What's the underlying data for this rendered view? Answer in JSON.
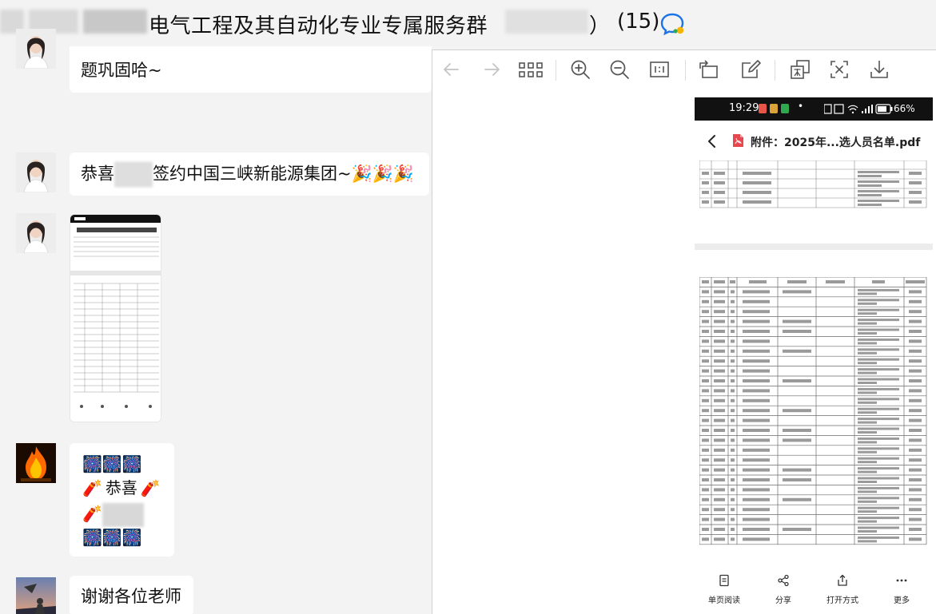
{
  "window": {
    "group_name": "电气工程及其自动化专业专属服务群",
    "paren_close": "）",
    "member_count": "(15)"
  },
  "chat": {
    "messages": [
      {
        "sender": "member-1",
        "text": "题巩固哈~"
      },
      {
        "sender": "member-1",
        "text_before": "恭喜",
        "text_after": "签约中国三峡新能源集团~",
        "emoji": "🎉🎉🎉"
      },
      {
        "sender": "member-1",
        "type": "image"
      },
      {
        "sender": "member-2",
        "sticker_label": "恭喜"
      },
      {
        "sender": "member-3",
        "text": "谢谢各位老师"
      }
    ]
  },
  "viewer": {
    "toolbar": [
      {
        "icon": "back-arrow-icon",
        "enabled": false
      },
      {
        "icon": "forward-arrow-icon",
        "enabled": false
      },
      {
        "icon": "grid-icon",
        "enabled": true
      },
      {
        "icon": "zoom-in-icon",
        "enabled": true
      },
      {
        "icon": "zoom-out-icon",
        "enabled": true
      },
      {
        "icon": "actual-size-icon",
        "enabled": true
      },
      {
        "icon": "rotate-icon",
        "enabled": true
      },
      {
        "icon": "edit-icon",
        "enabled": true
      },
      {
        "icon": "translate-icon",
        "enabled": true
      },
      {
        "icon": "extract-text-icon",
        "enabled": true
      },
      {
        "icon": "download-icon",
        "enabled": true
      }
    ],
    "phone": {
      "time": "19:29",
      "battery": "66%",
      "doc_title": "附件：2025年...选人员名单.pdf",
      "footer": [
        {
          "label": "单页阅读",
          "icon": "single-page-icon"
        },
        {
          "label": "分享",
          "icon": "share-icon"
        },
        {
          "label": "打开方式",
          "icon": "open-with-icon"
        },
        {
          "label": "更多",
          "icon": "more-icon"
        }
      ]
    }
  },
  "colors": {
    "background": "#f3f3f3",
    "bubble": "#ffffff",
    "pdf_red": "#e8474d",
    "icon_gray": "#555555",
    "disabled_gray": "#c4c4c4"
  }
}
